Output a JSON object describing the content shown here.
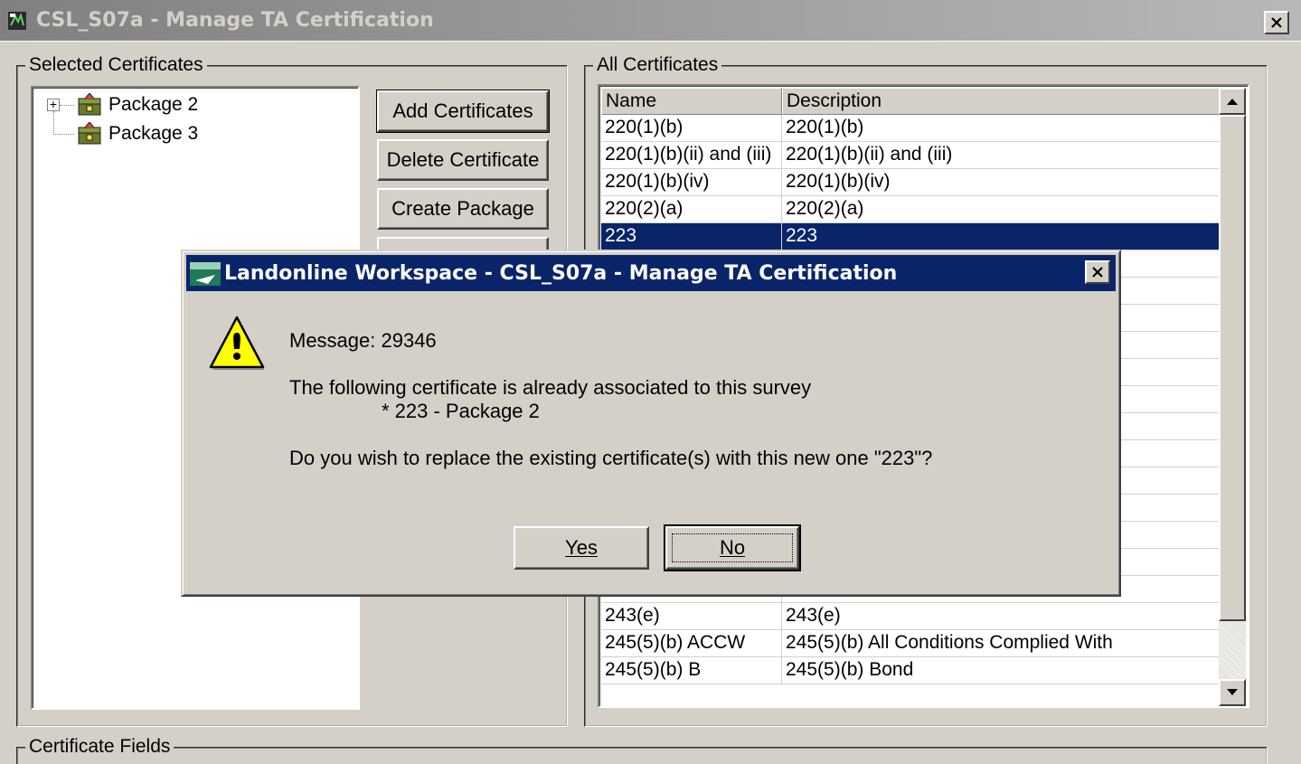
{
  "window": {
    "title": "CSL_S07a - Manage TA Certification"
  },
  "selected_certificates": {
    "label": "Selected Certificates",
    "tree": [
      {
        "label": "Package 2",
        "expandable": true
      },
      {
        "label": "Package 3",
        "expandable": false
      }
    ]
  },
  "buttons": {
    "add": "Add Certificates",
    "delete": "Delete Certificate",
    "create_package": "Create Package"
  },
  "all_certificates": {
    "label": "All Certificates",
    "columns": [
      "Name",
      "Description"
    ],
    "rows_top": [
      {
        "name": "220(1)(b)",
        "desc": "220(1)(b)"
      },
      {
        "name": "220(1)(b)(ii) and (iii)",
        "desc": "220(1)(b)(ii) and (iii)"
      },
      {
        "name": "220(1)(b)(iv)",
        "desc": "220(1)(b)(iv)"
      },
      {
        "name": "220(2)(a)",
        "desc": "220(2)(a)"
      },
      {
        "name": "223",
        "desc": "223",
        "selected": true
      }
    ],
    "rows_bottom": [
      {
        "name": "243(e)",
        "desc": "243(e)"
      },
      {
        "name": "245(5)(b) ACCW",
        "desc": "245(5)(b) All Conditions Complied With"
      },
      {
        "name": "245(5)(b) B",
        "desc": "245(5)(b) Bond"
      }
    ]
  },
  "certificate_fields": {
    "label": "Certificate Fields"
  },
  "dialog": {
    "title": "Landonline Workspace - CSL_S07a - Manage TA Certification",
    "message_id": "Message: 29346",
    "line1": "The following certificate is already associated to this survey",
    "line2": "* 223 - Package 2",
    "line3": "Do you wish to replace the existing certificate(s) with this new one \"223\"?",
    "yes": "Yes",
    "no": "No"
  },
  "colors": {
    "face": "#d4d0c8",
    "active_title": "#0a246a",
    "selection": "#0a246a"
  }
}
